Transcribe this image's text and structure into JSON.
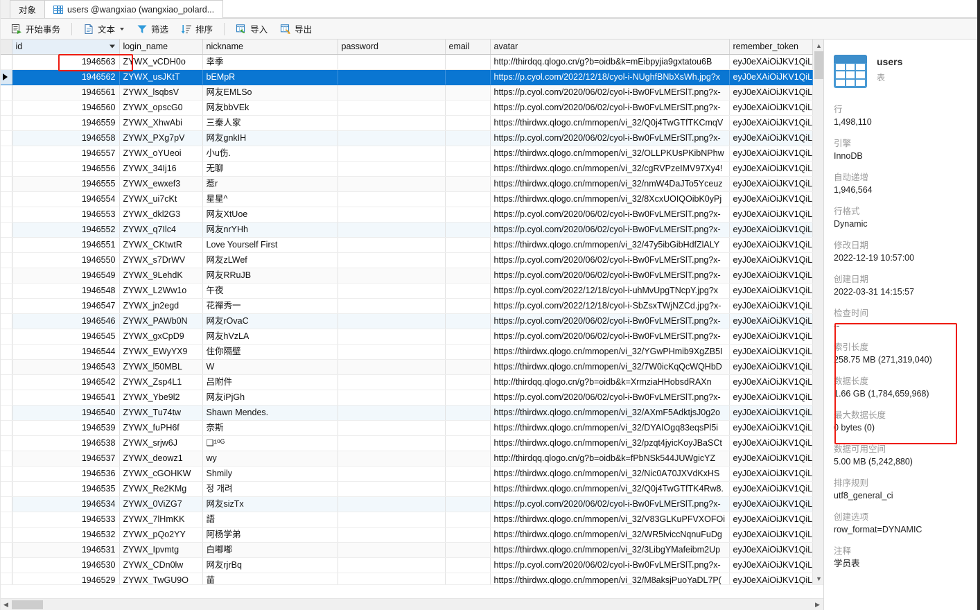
{
  "tabs": [
    {
      "label": "对象",
      "icon": null,
      "active": false
    },
    {
      "label": "users @wangxiao (wangxiao_polard...",
      "icon": "grid-icon",
      "active": true
    }
  ],
  "toolbar": {
    "begin_transaction": "开始事务",
    "text": "文本",
    "filter": "筛选",
    "sort": "排序",
    "import": "导入",
    "export": "导出"
  },
  "grid": {
    "columns": [
      {
        "key": "id",
        "label": "id",
        "sorted": true
      },
      {
        "key": "login_name",
        "label": "login_name"
      },
      {
        "key": "nickname",
        "label": "nickname"
      },
      {
        "key": "password",
        "label": "password"
      },
      {
        "key": "email",
        "label": "email"
      },
      {
        "key": "avatar",
        "label": "avatar"
      },
      {
        "key": "remember_token",
        "label": "remember_token"
      }
    ],
    "token_value": "eyJ0eXAiOiJKV1QiLCJh",
    "selected_row_index": 1,
    "rows": [
      {
        "id": "1946563",
        "login_name": "ZYWX_vCDH0o",
        "nickname": "幸季",
        "password": "",
        "email": "",
        "avatar": "http://thirdqq.qlogo.cn/g?b=oidb&k=mEibpyjia9gxtatou6B"
      },
      {
        "id": "1946562",
        "login_name": "ZYWX_usJKtT",
        "nickname": "bEMpR",
        "password": "",
        "email": "",
        "avatar": "https://p.cyol.com/2022/12/18/cyol-i-NUghfBNbXsWh.jpg?x"
      },
      {
        "id": "1946561",
        "login_name": "ZYWX_lsqbsV",
        "nickname": "网友EMLSo",
        "password": "",
        "email": "",
        "avatar": "https://p.cyol.com/2020/06/02/cyol-i-Bw0FvLMErSlT.png?x-"
      },
      {
        "id": "1946560",
        "login_name": "ZYWX_opscG0",
        "nickname": "网友bbVEk",
        "password": "",
        "email": "",
        "avatar": "https://p.cyol.com/2020/06/02/cyol-i-Bw0FvLMErSlT.png?x-"
      },
      {
        "id": "1946559",
        "login_name": "ZYWX_XhwAbi",
        "nickname": "三秦人家",
        "password": "",
        "email": "",
        "avatar": "https://thirdwx.qlogo.cn/mmopen/vi_32/Q0j4TwGTfTKCmqV"
      },
      {
        "id": "1946558",
        "login_name": "ZYWX_PXg7pV",
        "nickname": "网友gnkIH",
        "password": "",
        "email": "",
        "avatar": "https://p.cyol.com/2020/06/02/cyol-i-Bw0FvLMErSlT.png?x-"
      },
      {
        "id": "1946557",
        "login_name": "ZYWX_oYUeoi",
        "nickname": "小u伤.",
        "password": "",
        "email": "",
        "avatar": "https://thirdwx.qlogo.cn/mmopen/vi_32/OLLPKUsPKibNPhw"
      },
      {
        "id": "1946556",
        "login_name": "ZYWX_34Ij16",
        "nickname": "无聊",
        "password": "",
        "email": "",
        "avatar": "https://thirdwx.qlogo.cn/mmopen/vi_32/cgRVPzeIMV97Xy4!"
      },
      {
        "id": "1946555",
        "login_name": "ZYWX_ewxef3",
        "nickname": "惹r",
        "password": "",
        "email": "",
        "avatar": "https://thirdwx.qlogo.cn/mmopen/vi_32/nmW4DaJTo5Yceuz"
      },
      {
        "id": "1946554",
        "login_name": "ZYWX_ui7cKt",
        "nickname": "星星^",
        "password": "",
        "email": "",
        "avatar": "https://thirdwx.qlogo.cn/mmopen/vi_32/8XcxUOIQOibK0yPj"
      },
      {
        "id": "1946553",
        "login_name": "ZYWX_dkl2G3",
        "nickname": "网友XtUoe",
        "password": "",
        "email": "",
        "avatar": "https://p.cyol.com/2020/06/02/cyol-i-Bw0FvLMErSlT.png?x-"
      },
      {
        "id": "1946552",
        "login_name": "ZYWX_q7Ilc4",
        "nickname": "网友nrYHh",
        "password": "",
        "email": "",
        "avatar": "https://p.cyol.com/2020/06/02/cyol-i-Bw0FvLMErSlT.png?x-"
      },
      {
        "id": "1946551",
        "login_name": "ZYWX_CKtwtR",
        "nickname": "Love  Yourself  First",
        "password": "",
        "email": "",
        "avatar": "https://thirdwx.qlogo.cn/mmopen/vi_32/47y5ibGibHdfZlALY"
      },
      {
        "id": "1946550",
        "login_name": "ZYWX_s7DrWV",
        "nickname": "网友zLWef",
        "password": "",
        "email": "",
        "avatar": "https://p.cyol.com/2020/06/02/cyol-i-Bw0FvLMErSlT.png?x-"
      },
      {
        "id": "1946549",
        "login_name": "ZYWX_9LehdK",
        "nickname": "网友RRuJB",
        "password": "",
        "email": "",
        "avatar": "https://p.cyol.com/2020/06/02/cyol-i-Bw0FvLMErSlT.png?x-"
      },
      {
        "id": "1946548",
        "login_name": "ZYWX_L2Ww1o",
        "nickname": "午夜",
        "password": "",
        "email": "",
        "avatar": "https://p.cyol.com/2022/12/18/cyol-i-uhMvUpgTNcpY.jpg?x"
      },
      {
        "id": "1946547",
        "login_name": "ZYWX_jn2egd",
        "nickname": "花禪秀一",
        "password": "",
        "email": "",
        "avatar": "https://p.cyol.com/2022/12/18/cyol-i-SbZsxTWjNZCd.jpg?x-"
      },
      {
        "id": "1946546",
        "login_name": "ZYWX_PAWb0N",
        "nickname": "网友rOvaC",
        "password": "",
        "email": "",
        "avatar": "https://p.cyol.com/2020/06/02/cyol-i-Bw0FvLMErSlT.png?x-"
      },
      {
        "id": "1946545",
        "login_name": "ZYWX_gxCpD9",
        "nickname": "网友hVzLA",
        "password": "",
        "email": "",
        "avatar": "https://p.cyol.com/2020/06/02/cyol-i-Bw0FvLMErSlT.png?x-"
      },
      {
        "id": "1946544",
        "login_name": "ZYWX_EWyYX9",
        "nickname": "住你隔壁",
        "password": "",
        "email": "",
        "avatar": "https://thirdwx.qlogo.cn/mmopen/vi_32/YGwPHmib9XgZB5I"
      },
      {
        "id": "1946543",
        "login_name": "ZYWX_l50MBL",
        "nickname": "W",
        "password": "",
        "email": "",
        "avatar": "https://thirdwx.qlogo.cn/mmopen/vi_32/7W0icKqQcWQHbD"
      },
      {
        "id": "1946542",
        "login_name": "ZYWX_Zsp4L1",
        "nickname": " 吕附件",
        "password": "",
        "email": "",
        "avatar": "http://thirdqq.qlogo.cn/g?b=oidb&k=XrmziaHHobsdRAXn"
      },
      {
        "id": "1946541",
        "login_name": "ZYWX_Ybe9l2",
        "nickname": "网友iPjGh",
        "password": "",
        "email": "",
        "avatar": "https://p.cyol.com/2020/06/02/cyol-i-Bw0FvLMErSlT.png?x-"
      },
      {
        "id": "1946540",
        "login_name": "ZYWX_Tu74tw",
        "nickname": "Shawn Mendes.",
        "password": "",
        "email": "",
        "avatar": "https://thirdwx.qlogo.cn/mmopen/vi_32/AXmF5AdktjsJ0g2o"
      },
      {
        "id": "1946539",
        "login_name": "ZYWX_fuPH6f",
        "nickname": "奈斯",
        "password": "",
        "email": "",
        "avatar": "https://thirdwx.qlogo.cn/mmopen/vi_32/DYAIOgq83eqsPl5i"
      },
      {
        "id": "1946538",
        "login_name": "ZYWX_srjw6J",
        "nickname": "❏¹⁰ᴳ",
        "password": "",
        "email": "",
        "avatar": "https://thirdwx.qlogo.cn/mmopen/vi_32/pzqt4jyicKoyJBaSCt"
      },
      {
        "id": "1946537",
        "login_name": "ZYWX_deowz1",
        "nickname": "wy",
        "password": "",
        "email": "",
        "avatar": "http://thirdqq.qlogo.cn/g?b=oidb&k=fPbNSk544JUWgicYZ"
      },
      {
        "id": "1946536",
        "login_name": "ZYWX_cGOHKW",
        "nickname": "Shmily",
        "password": "",
        "email": "",
        "avatar": "https://thirdwx.qlogo.cn/mmopen/vi_32/Nic0A70JXVdKxHS"
      },
      {
        "id": "1946535",
        "login_name": "ZYWX_Re2KMg",
        "nickname": "정 개려",
        "password": "",
        "email": "",
        "avatar": "https://thirdwx.qlogo.cn/mmopen/vi_32/Q0j4TwGTfTK4Rw8."
      },
      {
        "id": "1946534",
        "login_name": "ZYWX_0ViZG7",
        "nickname": "网友sizTx",
        "password": "",
        "email": "",
        "avatar": "https://p.cyol.com/2020/06/02/cyol-i-Bw0FvLMErSlT.png?x-"
      },
      {
        "id": "1946533",
        "login_name": "ZYWX_7lHmKK",
        "nickname": "語",
        "password": "",
        "email": "",
        "avatar": "https://thirdwx.qlogo.cn/mmopen/vi_32/V83GLKuPFVXOFOi"
      },
      {
        "id": "1946532",
        "login_name": "ZYWX_pQo2YY",
        "nickname": "阿杨学弟",
        "password": "",
        "email": "",
        "avatar": "https://thirdwx.qlogo.cn/mmopen/vi_32/WR5lviccNqnuFuDg"
      },
      {
        "id": "1946531",
        "login_name": "ZYWX_Ipvmtg",
        "nickname": "白嘟嘟",
        "password": "",
        "email": "",
        "avatar": "https://thirdwx.qlogo.cn/mmopen/vi_32/3LibgYMafeibm2Up"
      },
      {
        "id": "1946530",
        "login_name": "ZYWX_CDn0lw",
        "nickname": "网友rjrBq",
        "password": "",
        "email": "",
        "avatar": "https://p.cyol.com/2020/06/02/cyol-i-Bw0FvLMErSlT.png?x-"
      },
      {
        "id": "1946529",
        "login_name": "ZYWX_TwGU9O",
        "nickname": "苗",
        "password": "",
        "email": "",
        "avatar": "https://thirdwx.qlogo.cn/mmopen/vi_32/M8aksjPuoYaDL7P("
      }
    ]
  },
  "info": {
    "title": "users",
    "subtitle": "表",
    "fields": [
      {
        "key": "行",
        "value": "1,498,110"
      },
      {
        "key": "引擎",
        "value": "InnoDB"
      },
      {
        "key": "自动递增",
        "value": "1,946,564"
      },
      {
        "key": "行格式",
        "value": "Dynamic"
      },
      {
        "key": "修改日期",
        "value": "2022-12-19 10:57:00"
      },
      {
        "key": "创建日期",
        "value": "2022-03-31 14:15:57"
      },
      {
        "key": "检查时间",
        "value": "--"
      },
      {
        "key": "索引长度",
        "value": "258.75 MB (271,319,040)"
      },
      {
        "key": "数据长度",
        "value": "1.66 GB (1,784,659,968)"
      },
      {
        "key": "最大数据长度",
        "value": "0 bytes (0)"
      },
      {
        "key": "数据可用空间",
        "value": "5.00 MB (5,242,880)"
      },
      {
        "key": "排序规则",
        "value": "utf8_general_ci"
      },
      {
        "key": "创建选项",
        "value": "row_format=DYNAMIC"
      },
      {
        "key": "注释",
        "value": "学员表"
      }
    ]
  },
  "annotations": {
    "highlight_color": "#ee1b11",
    "accent_color": "#0a76d2"
  }
}
